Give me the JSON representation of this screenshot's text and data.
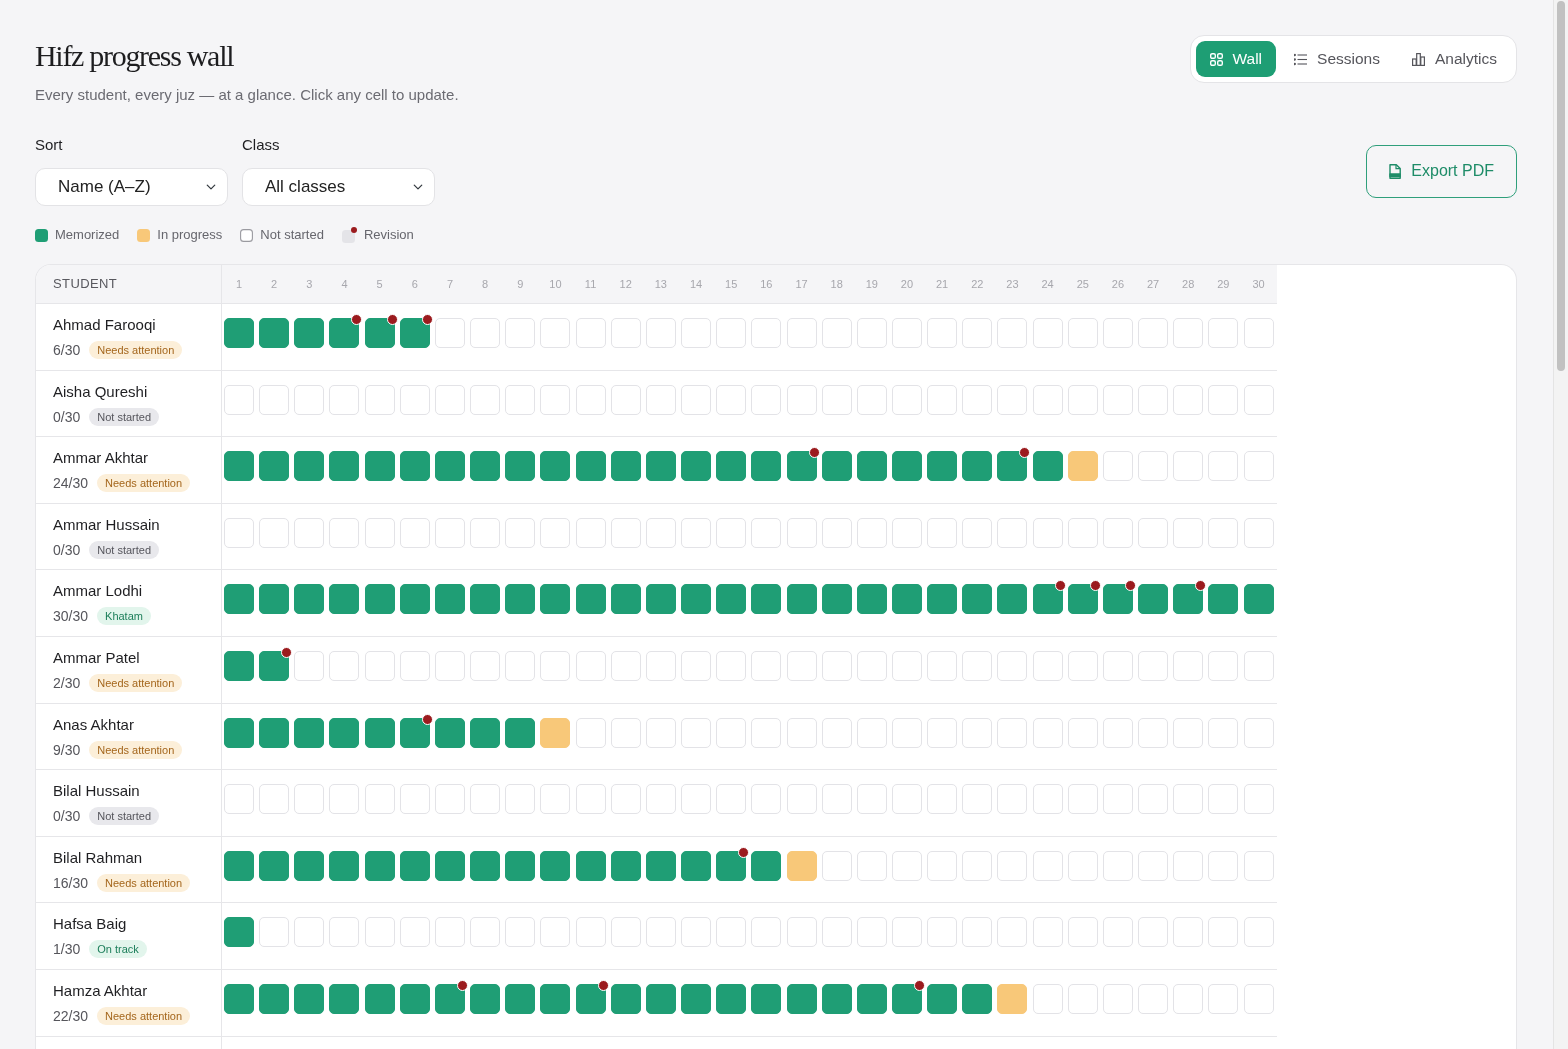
{
  "header": {
    "title": "Hifz progress wall",
    "subtitle": "Every student, every juz — at a glance. Click any cell to update."
  },
  "view_tabs": [
    {
      "label": "Wall",
      "selected": true
    },
    {
      "label": "Sessions",
      "selected": false
    },
    {
      "label": "Analytics",
      "selected": false
    }
  ],
  "filters": [
    {
      "label": "Sort",
      "value": "Name (A–Z)"
    },
    {
      "label": "Class",
      "value": "All classes"
    }
  ],
  "export_button": "Export PDF",
  "legend": [
    {
      "kind": "memorized",
      "label": "Memorized"
    },
    {
      "kind": "in_progress",
      "label": "In progress"
    },
    {
      "kind": "not_started",
      "label": "Not started"
    },
    {
      "kind": "revision",
      "label": "Revision"
    }
  ],
  "table": {
    "student_column": "STUDENT",
    "juz_columns": [
      "1",
      "2",
      "3",
      "4",
      "5",
      "6",
      "7",
      "8",
      "9",
      "10",
      "11",
      "12",
      "13",
      "14",
      "15",
      "16",
      "17",
      "18",
      "19",
      "20",
      "21",
      "22",
      "23",
      "24",
      "25",
      "26",
      "27",
      "28",
      "29",
      "30"
    ]
  },
  "students": [
    {
      "name": "Ahmad Farooqi",
      "progress": "6/30",
      "status": {
        "kind": "attention",
        "label": "Needs attention"
      },
      "juz": [
        {
          "kind": "memorized",
          "revision": false
        },
        {
          "kind": "memorized",
          "revision": false
        },
        {
          "kind": "memorized",
          "revision": false
        },
        {
          "kind": "memorized",
          "revision": true
        },
        {
          "kind": "memorized",
          "revision": true
        },
        {
          "kind": "memorized",
          "revision": true
        },
        {
          "kind": "not_started",
          "revision": false
        },
        {
          "kind": "not_started",
          "revision": false
        },
        {
          "kind": "not_started",
          "revision": false
        },
        {
          "kind": "not_started",
          "revision": false
        },
        {
          "kind": "not_started",
          "revision": false
        },
        {
          "kind": "not_started",
          "revision": false
        },
        {
          "kind": "not_started",
          "revision": false
        },
        {
          "kind": "not_started",
          "revision": false
        },
        {
          "kind": "not_started",
          "revision": false
        },
        {
          "kind": "not_started",
          "revision": false
        },
        {
          "kind": "not_started",
          "revision": false
        },
        {
          "kind": "not_started",
          "revision": false
        },
        {
          "kind": "not_started",
          "revision": false
        },
        {
          "kind": "not_started",
          "revision": false
        },
        {
          "kind": "not_started",
          "revision": false
        },
        {
          "kind": "not_started",
          "revision": false
        },
        {
          "kind": "not_started",
          "revision": false
        },
        {
          "kind": "not_started",
          "revision": false
        },
        {
          "kind": "not_started",
          "revision": false
        },
        {
          "kind": "not_started",
          "revision": false
        },
        {
          "kind": "not_started",
          "revision": false
        },
        {
          "kind": "not_started",
          "revision": false
        },
        {
          "kind": "not_started",
          "revision": false
        },
        {
          "kind": "not_started",
          "revision": false
        }
      ]
    },
    {
      "name": "Aisha Qureshi",
      "progress": "0/30",
      "status": {
        "kind": "not_started",
        "label": "Not started"
      },
      "juz": [
        {
          "kind": "not_started",
          "revision": false
        },
        {
          "kind": "not_started",
          "revision": false
        },
        {
          "kind": "not_started",
          "revision": false
        },
        {
          "kind": "not_started",
          "revision": false
        },
        {
          "kind": "not_started",
          "revision": false
        },
        {
          "kind": "not_started",
          "revision": false
        },
        {
          "kind": "not_started",
          "revision": false
        },
        {
          "kind": "not_started",
          "revision": false
        },
        {
          "kind": "not_started",
          "revision": false
        },
        {
          "kind": "not_started",
          "revision": false
        },
        {
          "kind": "not_started",
          "revision": false
        },
        {
          "kind": "not_started",
          "revision": false
        },
        {
          "kind": "not_started",
          "revision": false
        },
        {
          "kind": "not_started",
          "revision": false
        },
        {
          "kind": "not_started",
          "revision": false
        },
        {
          "kind": "not_started",
          "revision": false
        },
        {
          "kind": "not_started",
          "revision": false
        },
        {
          "kind": "not_started",
          "revision": false
        },
        {
          "kind": "not_started",
          "revision": false
        },
        {
          "kind": "not_started",
          "revision": false
        },
        {
          "kind": "not_started",
          "revision": false
        },
        {
          "kind": "not_started",
          "revision": false
        },
        {
          "kind": "not_started",
          "revision": false
        },
        {
          "kind": "not_started",
          "revision": false
        },
        {
          "kind": "not_started",
          "revision": false
        },
        {
          "kind": "not_started",
          "revision": false
        },
        {
          "kind": "not_started",
          "revision": false
        },
        {
          "kind": "not_started",
          "revision": false
        },
        {
          "kind": "not_started",
          "revision": false
        },
        {
          "kind": "not_started",
          "revision": false
        }
      ]
    },
    {
      "name": "Ammar Akhtar",
      "progress": "24/30",
      "status": {
        "kind": "attention",
        "label": "Needs attention"
      },
      "juz": [
        {
          "kind": "memorized",
          "revision": false
        },
        {
          "kind": "memorized",
          "revision": false
        },
        {
          "kind": "memorized",
          "revision": false
        },
        {
          "kind": "memorized",
          "revision": false
        },
        {
          "kind": "memorized",
          "revision": false
        },
        {
          "kind": "memorized",
          "revision": false
        },
        {
          "kind": "memorized",
          "revision": false
        },
        {
          "kind": "memorized",
          "revision": false
        },
        {
          "kind": "memorized",
          "revision": false
        },
        {
          "kind": "memorized",
          "revision": false
        },
        {
          "kind": "memorized",
          "revision": false
        },
        {
          "kind": "memorized",
          "revision": false
        },
        {
          "kind": "memorized",
          "revision": false
        },
        {
          "kind": "memorized",
          "revision": false
        },
        {
          "kind": "memorized",
          "revision": false
        },
        {
          "kind": "memorized",
          "revision": false
        },
        {
          "kind": "memorized",
          "revision": true
        },
        {
          "kind": "memorized",
          "revision": false
        },
        {
          "kind": "memorized",
          "revision": false
        },
        {
          "kind": "memorized",
          "revision": false
        },
        {
          "kind": "memorized",
          "revision": false
        },
        {
          "kind": "memorized",
          "revision": false
        },
        {
          "kind": "memorized",
          "revision": true
        },
        {
          "kind": "memorized",
          "revision": false
        },
        {
          "kind": "in_progress",
          "revision": false
        },
        {
          "kind": "not_started",
          "revision": false
        },
        {
          "kind": "not_started",
          "revision": false
        },
        {
          "kind": "not_started",
          "revision": false
        },
        {
          "kind": "not_started",
          "revision": false
        },
        {
          "kind": "not_started",
          "revision": false
        }
      ]
    },
    {
      "name": "Ammar Hussain",
      "progress": "0/30",
      "status": {
        "kind": "not_started",
        "label": "Not started"
      },
      "juz": [
        {
          "kind": "not_started",
          "revision": false
        },
        {
          "kind": "not_started",
          "revision": false
        },
        {
          "kind": "not_started",
          "revision": false
        },
        {
          "kind": "not_started",
          "revision": false
        },
        {
          "kind": "not_started",
          "revision": false
        },
        {
          "kind": "not_started",
          "revision": false
        },
        {
          "kind": "not_started",
          "revision": false
        },
        {
          "kind": "not_started",
          "revision": false
        },
        {
          "kind": "not_started",
          "revision": false
        },
        {
          "kind": "not_started",
          "revision": false
        },
        {
          "kind": "not_started",
          "revision": false
        },
        {
          "kind": "not_started",
          "revision": false
        },
        {
          "kind": "not_started",
          "revision": false
        },
        {
          "kind": "not_started",
          "revision": false
        },
        {
          "kind": "not_started",
          "revision": false
        },
        {
          "kind": "not_started",
          "revision": false
        },
        {
          "kind": "not_started",
          "revision": false
        },
        {
          "kind": "not_started",
          "revision": false
        },
        {
          "kind": "not_started",
          "revision": false
        },
        {
          "kind": "not_started",
          "revision": false
        },
        {
          "kind": "not_started",
          "revision": false
        },
        {
          "kind": "not_started",
          "revision": false
        },
        {
          "kind": "not_started",
          "revision": false
        },
        {
          "kind": "not_started",
          "revision": false
        },
        {
          "kind": "not_started",
          "revision": false
        },
        {
          "kind": "not_started",
          "revision": false
        },
        {
          "kind": "not_started",
          "revision": false
        },
        {
          "kind": "not_started",
          "revision": false
        },
        {
          "kind": "not_started",
          "revision": false
        },
        {
          "kind": "not_started",
          "revision": false
        }
      ]
    },
    {
      "name": "Ammar Lodhi",
      "progress": "30/30",
      "status": {
        "kind": "complete",
        "label": "Khatam"
      },
      "juz": [
        {
          "kind": "memorized",
          "revision": false
        },
        {
          "kind": "memorized",
          "revision": false
        },
        {
          "kind": "memorized",
          "revision": false
        },
        {
          "kind": "memorized",
          "revision": false
        },
        {
          "kind": "memorized",
          "revision": false
        },
        {
          "kind": "memorized",
          "revision": false
        },
        {
          "kind": "memorized",
          "revision": false
        },
        {
          "kind": "memorized",
          "revision": false
        },
        {
          "kind": "memorized",
          "revision": false
        },
        {
          "kind": "memorized",
          "revision": false
        },
        {
          "kind": "memorized",
          "revision": false
        },
        {
          "kind": "memorized",
          "revision": false
        },
        {
          "kind": "memorized",
          "revision": false
        },
        {
          "kind": "memorized",
          "revision": false
        },
        {
          "kind": "memorized",
          "revision": false
        },
        {
          "kind": "memorized",
          "revision": false
        },
        {
          "kind": "memorized",
          "revision": false
        },
        {
          "kind": "memorized",
          "revision": false
        },
        {
          "kind": "memorized",
          "revision": false
        },
        {
          "kind": "memorized",
          "revision": false
        },
        {
          "kind": "memorized",
          "revision": false
        },
        {
          "kind": "memorized",
          "revision": false
        },
        {
          "kind": "memorized",
          "revision": false
        },
        {
          "kind": "memorized",
          "revision": true
        },
        {
          "kind": "memorized",
          "revision": true
        },
        {
          "kind": "memorized",
          "revision": true
        },
        {
          "kind": "memorized",
          "revision": false
        },
        {
          "kind": "memorized",
          "revision": true
        },
        {
          "kind": "memorized",
          "revision": false
        },
        {
          "kind": "memorized",
          "revision": false
        }
      ]
    },
    {
      "name": "Ammar Patel",
      "progress": "2/30",
      "status": {
        "kind": "attention",
        "label": "Needs attention"
      },
      "juz": [
        {
          "kind": "memorized",
          "revision": false
        },
        {
          "kind": "memorized",
          "revision": true
        },
        {
          "kind": "not_started",
          "revision": false
        },
        {
          "kind": "not_started",
          "revision": false
        },
        {
          "kind": "not_started",
          "revision": false
        },
        {
          "kind": "not_started",
          "revision": false
        },
        {
          "kind": "not_started",
          "revision": false
        },
        {
          "kind": "not_started",
          "revision": false
        },
        {
          "kind": "not_started",
          "revision": false
        },
        {
          "kind": "not_started",
          "revision": false
        },
        {
          "kind": "not_started",
          "revision": false
        },
        {
          "kind": "not_started",
          "revision": false
        },
        {
          "kind": "not_started",
          "revision": false
        },
        {
          "kind": "not_started",
          "revision": false
        },
        {
          "kind": "not_started",
          "revision": false
        },
        {
          "kind": "not_started",
          "revision": false
        },
        {
          "kind": "not_started",
          "revision": false
        },
        {
          "kind": "not_started",
          "revision": false
        },
        {
          "kind": "not_started",
          "revision": false
        },
        {
          "kind": "not_started",
          "revision": false
        },
        {
          "kind": "not_started",
          "revision": false
        },
        {
          "kind": "not_started",
          "revision": false
        },
        {
          "kind": "not_started",
          "revision": false
        },
        {
          "kind": "not_started",
          "revision": false
        },
        {
          "kind": "not_started",
          "revision": false
        },
        {
          "kind": "not_started",
          "revision": false
        },
        {
          "kind": "not_started",
          "revision": false
        },
        {
          "kind": "not_started",
          "revision": false
        },
        {
          "kind": "not_started",
          "revision": false
        },
        {
          "kind": "not_started",
          "revision": false
        }
      ]
    },
    {
      "name": "Anas Akhtar",
      "progress": "9/30",
      "status": {
        "kind": "attention",
        "label": "Needs attention"
      },
      "juz": [
        {
          "kind": "memorized",
          "revision": false
        },
        {
          "kind": "memorized",
          "revision": false
        },
        {
          "kind": "memorized",
          "revision": false
        },
        {
          "kind": "memorized",
          "revision": false
        },
        {
          "kind": "memorized",
          "revision": false
        },
        {
          "kind": "memorized",
          "revision": true
        },
        {
          "kind": "memorized",
          "revision": false
        },
        {
          "kind": "memorized",
          "revision": false
        },
        {
          "kind": "memorized",
          "revision": false
        },
        {
          "kind": "in_progress",
          "revision": false
        },
        {
          "kind": "not_started",
          "revision": false
        },
        {
          "kind": "not_started",
          "revision": false
        },
        {
          "kind": "not_started",
          "revision": false
        },
        {
          "kind": "not_started",
          "revision": false
        },
        {
          "kind": "not_started",
          "revision": false
        },
        {
          "kind": "not_started",
          "revision": false
        },
        {
          "kind": "not_started",
          "revision": false
        },
        {
          "kind": "not_started",
          "revision": false
        },
        {
          "kind": "not_started",
          "revision": false
        },
        {
          "kind": "not_started",
          "revision": false
        },
        {
          "kind": "not_started",
          "revision": false
        },
        {
          "kind": "not_started",
          "revision": false
        },
        {
          "kind": "not_started",
          "revision": false
        },
        {
          "kind": "not_started",
          "revision": false
        },
        {
          "kind": "not_started",
          "revision": false
        },
        {
          "kind": "not_started",
          "revision": false
        },
        {
          "kind": "not_started",
          "revision": false
        },
        {
          "kind": "not_started",
          "revision": false
        },
        {
          "kind": "not_started",
          "revision": false
        },
        {
          "kind": "not_started",
          "revision": false
        }
      ]
    },
    {
      "name": "Bilal Hussain",
      "progress": "0/30",
      "status": {
        "kind": "not_started",
        "label": "Not started"
      },
      "juz": [
        {
          "kind": "not_started",
          "revision": false
        },
        {
          "kind": "not_started",
          "revision": false
        },
        {
          "kind": "not_started",
          "revision": false
        },
        {
          "kind": "not_started",
          "revision": false
        },
        {
          "kind": "not_started",
          "revision": false
        },
        {
          "kind": "not_started",
          "revision": false
        },
        {
          "kind": "not_started",
          "revision": false
        },
        {
          "kind": "not_started",
          "revision": false
        },
        {
          "kind": "not_started",
          "revision": false
        },
        {
          "kind": "not_started",
          "revision": false
        },
        {
          "kind": "not_started",
          "revision": false
        },
        {
          "kind": "not_started",
          "revision": false
        },
        {
          "kind": "not_started",
          "revision": false
        },
        {
          "kind": "not_started",
          "revision": false
        },
        {
          "kind": "not_started",
          "revision": false
        },
        {
          "kind": "not_started",
          "revision": false
        },
        {
          "kind": "not_started",
          "revision": false
        },
        {
          "kind": "not_started",
          "revision": false
        },
        {
          "kind": "not_started",
          "revision": false
        },
        {
          "kind": "not_started",
          "revision": false
        },
        {
          "kind": "not_started",
          "revision": false
        },
        {
          "kind": "not_started",
          "revision": false
        },
        {
          "kind": "not_started",
          "revision": false
        },
        {
          "kind": "not_started",
          "revision": false
        },
        {
          "kind": "not_started",
          "revision": false
        },
        {
          "kind": "not_started",
          "revision": false
        },
        {
          "kind": "not_started",
          "revision": false
        },
        {
          "kind": "not_started",
          "revision": false
        },
        {
          "kind": "not_started",
          "revision": false
        },
        {
          "kind": "not_started",
          "revision": false
        }
      ]
    },
    {
      "name": "Bilal Rahman",
      "progress": "16/30",
      "status": {
        "kind": "attention",
        "label": "Needs attention"
      },
      "juz": [
        {
          "kind": "memorized",
          "revision": false
        },
        {
          "kind": "memorized",
          "revision": false
        },
        {
          "kind": "memorized",
          "revision": false
        },
        {
          "kind": "memorized",
          "revision": false
        },
        {
          "kind": "memorized",
          "revision": false
        },
        {
          "kind": "memorized",
          "revision": false
        },
        {
          "kind": "memorized",
          "revision": false
        },
        {
          "kind": "memorized",
          "revision": false
        },
        {
          "kind": "memorized",
          "revision": false
        },
        {
          "kind": "memorized",
          "revision": false
        },
        {
          "kind": "memorized",
          "revision": false
        },
        {
          "kind": "memorized",
          "revision": false
        },
        {
          "kind": "memorized",
          "revision": false
        },
        {
          "kind": "memorized",
          "revision": false
        },
        {
          "kind": "memorized",
          "revision": true
        },
        {
          "kind": "memorized",
          "revision": false
        },
        {
          "kind": "in_progress",
          "revision": false
        },
        {
          "kind": "not_started",
          "revision": false
        },
        {
          "kind": "not_started",
          "revision": false
        },
        {
          "kind": "not_started",
          "revision": false
        },
        {
          "kind": "not_started",
          "revision": false
        },
        {
          "kind": "not_started",
          "revision": false
        },
        {
          "kind": "not_started",
          "revision": false
        },
        {
          "kind": "not_started",
          "revision": false
        },
        {
          "kind": "not_started",
          "revision": false
        },
        {
          "kind": "not_started",
          "revision": false
        },
        {
          "kind": "not_started",
          "revision": false
        },
        {
          "kind": "not_started",
          "revision": false
        },
        {
          "kind": "not_started",
          "revision": false
        },
        {
          "kind": "not_started",
          "revision": false
        }
      ]
    },
    {
      "name": "Hafsa Baig",
      "progress": "1/30",
      "status": {
        "kind": "on_track",
        "label": "On track"
      },
      "juz": [
        {
          "kind": "memorized",
          "revision": false
        },
        {
          "kind": "not_started",
          "revision": false
        },
        {
          "kind": "not_started",
          "revision": false
        },
        {
          "kind": "not_started",
          "revision": false
        },
        {
          "kind": "not_started",
          "revision": false
        },
        {
          "kind": "not_started",
          "revision": false
        },
        {
          "kind": "not_started",
          "revision": false
        },
        {
          "kind": "not_started",
          "revision": false
        },
        {
          "kind": "not_started",
          "revision": false
        },
        {
          "kind": "not_started",
          "revision": false
        },
        {
          "kind": "not_started",
          "revision": false
        },
        {
          "kind": "not_started",
          "revision": false
        },
        {
          "kind": "not_started",
          "revision": false
        },
        {
          "kind": "not_started",
          "revision": false
        },
        {
          "kind": "not_started",
          "revision": false
        },
        {
          "kind": "not_started",
          "revision": false
        },
        {
          "kind": "not_started",
          "revision": false
        },
        {
          "kind": "not_started",
          "revision": false
        },
        {
          "kind": "not_started",
          "revision": false
        },
        {
          "kind": "not_started",
          "revision": false
        },
        {
          "kind": "not_started",
          "revision": false
        },
        {
          "kind": "not_started",
          "revision": false
        },
        {
          "kind": "not_started",
          "revision": false
        },
        {
          "kind": "not_started",
          "revision": false
        },
        {
          "kind": "not_started",
          "revision": false
        },
        {
          "kind": "not_started",
          "revision": false
        },
        {
          "kind": "not_started",
          "revision": false
        },
        {
          "kind": "not_started",
          "revision": false
        },
        {
          "kind": "not_started",
          "revision": false
        },
        {
          "kind": "not_started",
          "revision": false
        }
      ]
    },
    {
      "name": "Hamza Akhtar",
      "progress": "22/30",
      "status": {
        "kind": "attention",
        "label": "Needs attention"
      },
      "juz": [
        {
          "kind": "memorized",
          "revision": false
        },
        {
          "kind": "memorized",
          "revision": false
        },
        {
          "kind": "memorized",
          "revision": false
        },
        {
          "kind": "memorized",
          "revision": false
        },
        {
          "kind": "memorized",
          "revision": false
        },
        {
          "kind": "memorized",
          "revision": false
        },
        {
          "kind": "memorized",
          "revision": true
        },
        {
          "kind": "memorized",
          "revision": false
        },
        {
          "kind": "memorized",
          "revision": false
        },
        {
          "kind": "memorized",
          "revision": false
        },
        {
          "kind": "memorized",
          "revision": true
        },
        {
          "kind": "memorized",
          "revision": false
        },
        {
          "kind": "memorized",
          "revision": false
        },
        {
          "kind": "memorized",
          "revision": false
        },
        {
          "kind": "memorized",
          "revision": false
        },
        {
          "kind": "memorized",
          "revision": false
        },
        {
          "kind": "memorized",
          "revision": false
        },
        {
          "kind": "memorized",
          "revision": false
        },
        {
          "kind": "memorized",
          "revision": false
        },
        {
          "kind": "memorized",
          "revision": true
        },
        {
          "kind": "memorized",
          "revision": false
        },
        {
          "kind": "memorized",
          "revision": false
        },
        {
          "kind": "in_progress",
          "revision": false
        },
        {
          "kind": "not_started",
          "revision": false
        },
        {
          "kind": "not_started",
          "revision": false
        },
        {
          "kind": "not_started",
          "revision": false
        },
        {
          "kind": "not_started",
          "revision": false
        },
        {
          "kind": "not_started",
          "revision": false
        },
        {
          "kind": "not_started",
          "revision": false
        },
        {
          "kind": "not_started",
          "revision": false
        }
      ]
    }
  ]
}
